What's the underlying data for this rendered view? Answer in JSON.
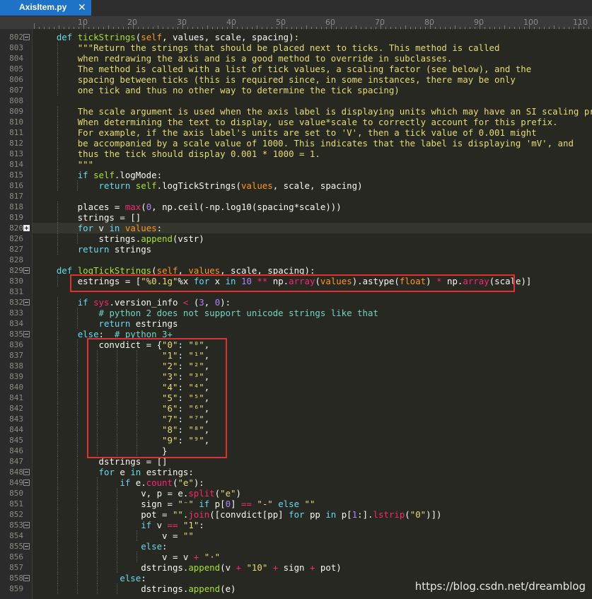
{
  "tab": {
    "title": "AxisItem.py",
    "close_glyph": "✕"
  },
  "ruler": {
    "labels": [
      "10",
      "20",
      "30",
      "40",
      "50",
      "60",
      "70",
      "80",
      "90",
      "100",
      "110"
    ]
  },
  "colors": {
    "keyword": "#66d9ef",
    "string": "#e6db74",
    "comment": "#75d3c3",
    "number": "#ae81ff",
    "builtin": "#a6e22e",
    "param": "#fd971f",
    "operator": "#f92672",
    "default": "#f8f8f2",
    "annotation_box": "#e03030"
  },
  "lines": [
    {
      "num": "802",
      "fold": "open",
      "tokens": [
        [
          "    "
        ],
        [
          "def",
          "kw"
        ],
        [
          " "
        ],
        [
          "tickStrings",
          "fn"
        ],
        [
          "("
        ],
        [
          "self",
          "par"
        ],
        [
          ", values, scale, spacing):"
        ]
      ]
    },
    {
      "num": "803",
      "tokens": [
        [
          "        "
        ],
        [
          "\"\"\"Return the strings that should be placed next to ticks. This method is called",
          "str"
        ]
      ]
    },
    {
      "num": "804",
      "tokens": [
        [
          "        "
        ],
        [
          "when redrawing the axis and is a good method to override in subclasses.",
          "str"
        ]
      ]
    },
    {
      "num": "805",
      "tokens": [
        [
          "        "
        ],
        [
          "The method is called with a list of tick values, a scaling factor (see below), and the",
          "str"
        ]
      ]
    },
    {
      "num": "806",
      "tokens": [
        [
          "        "
        ],
        [
          "spacing between ticks (this is required since, in some instances, there may be only",
          "str"
        ]
      ]
    },
    {
      "num": "807",
      "tokens": [
        [
          "        "
        ],
        [
          "one tick and thus no other way to determine the tick spacing)",
          "str"
        ]
      ]
    },
    {
      "num": "808",
      "tokens": [
        [
          ""
        ]
      ]
    },
    {
      "num": "809",
      "tokens": [
        [
          "        "
        ],
        [
          "The scale argument is used when the axis label is displaying units which may have an SI scaling prefix.",
          "str"
        ]
      ]
    },
    {
      "num": "810",
      "tokens": [
        [
          "        "
        ],
        [
          "When determining the text to display, use value*scale to correctly account for this prefix.",
          "str"
        ]
      ]
    },
    {
      "num": "811",
      "tokens": [
        [
          "        "
        ],
        [
          "For example, if the axis label's units are set to 'V', then a tick value of 0.001 might",
          "str"
        ]
      ]
    },
    {
      "num": "812",
      "tokens": [
        [
          "        "
        ],
        [
          "be accompanied by a scale value of 1000. This indicates that the label is displaying 'mV', and",
          "str"
        ]
      ]
    },
    {
      "num": "813",
      "tokens": [
        [
          "        "
        ],
        [
          "thus the tick should display 0.001 * 1000 = 1.",
          "str"
        ]
      ]
    },
    {
      "num": "814",
      "tokens": [
        [
          "        "
        ],
        [
          "\"\"\"",
          "str"
        ]
      ]
    },
    {
      "num": "815",
      "tokens": [
        [
          "        "
        ],
        [
          "if",
          "kw"
        ],
        [
          " "
        ],
        [
          "self",
          "bi"
        ],
        [
          ".logMode:"
        ]
      ]
    },
    {
      "num": "816",
      "tokens": [
        [
          "            "
        ],
        [
          "return",
          "kw"
        ],
        [
          " "
        ],
        [
          "self",
          "bi"
        ],
        [
          ".logTickStrings("
        ],
        [
          "values",
          "par"
        ],
        [
          ", scale, spacing)"
        ]
      ]
    },
    {
      "num": "817",
      "tokens": [
        [
          ""
        ]
      ]
    },
    {
      "num": "818",
      "tokens": [
        [
          "        places = "
        ],
        [
          "max",
          "op"
        ],
        [
          "("
        ],
        [
          "0",
          "num"
        ],
        [
          ", np.ceil(-np.log10(spacing*scale)))"
        ]
      ]
    },
    {
      "num": "819",
      "tokens": [
        [
          "        strings = []"
        ]
      ]
    },
    {
      "num": "820",
      "fold": "collapsed",
      "hl": true,
      "tokens": [
        [
          "        "
        ],
        [
          "for",
          "kw"
        ],
        [
          " v "
        ],
        [
          "in",
          "kw"
        ],
        [
          " "
        ],
        [
          "values",
          "par"
        ],
        [
          ":"
        ]
      ]
    },
    {
      "num": "826",
      "tokens": [
        [
          "            strings."
        ],
        [
          "append",
          "bi"
        ],
        [
          "(vstr)"
        ]
      ]
    },
    {
      "num": "827",
      "tokens": [
        [
          "        "
        ],
        [
          "return",
          "kw"
        ],
        [
          " strings"
        ]
      ]
    },
    {
      "num": "828",
      "tokens": [
        [
          ""
        ]
      ]
    },
    {
      "num": "829",
      "fold": "open",
      "tokens": [
        [
          "    "
        ],
        [
          "def",
          "kw"
        ],
        [
          " "
        ],
        [
          "logTickStrings",
          "fn"
        ],
        [
          "("
        ],
        [
          "self",
          "par"
        ],
        [
          ", "
        ],
        [
          "values",
          "par"
        ],
        [
          ", scale, spacing):"
        ]
      ]
    },
    {
      "num": "830",
      "tokens": [
        [
          "        estrings = ["
        ],
        [
          "\"%0.1g\"",
          "str"
        ],
        [
          "%x "
        ],
        [
          "for",
          "kw"
        ],
        [
          " x "
        ],
        [
          "in",
          "kw"
        ],
        [
          " "
        ],
        [
          "10",
          "num"
        ],
        [
          " "
        ],
        [
          "**",
          "op"
        ],
        [
          " np."
        ],
        [
          "array",
          "op"
        ],
        [
          "("
        ],
        [
          "values",
          "par"
        ],
        [
          ").astype("
        ],
        [
          "float",
          "par"
        ],
        [
          ") "
        ],
        [
          "*",
          "op"
        ],
        [
          " np."
        ],
        [
          "array",
          "op"
        ],
        [
          "(scale)]"
        ]
      ]
    },
    {
      "num": "831",
      "tokens": [
        [
          ""
        ]
      ]
    },
    {
      "num": "832",
      "fold": "open",
      "tokens": [
        [
          "        "
        ],
        [
          "if",
          "kw"
        ],
        [
          " "
        ],
        [
          "sys",
          "op"
        ],
        [
          ".version_info "
        ],
        [
          "<",
          "op"
        ],
        [
          " ("
        ],
        [
          "3",
          "num"
        ],
        [
          ", "
        ],
        [
          "0",
          "num"
        ],
        [
          "):"
        ]
      ]
    },
    {
      "num": "833",
      "tokens": [
        [
          "            "
        ],
        [
          "# python 2 does not support unicode strings like that",
          "cm"
        ]
      ]
    },
    {
      "num": "834",
      "tokens": [
        [
          "            "
        ],
        [
          "return",
          "kw"
        ],
        [
          " estrings"
        ]
      ]
    },
    {
      "num": "835",
      "fold": "open",
      "tokens": [
        [
          "        "
        ],
        [
          "else",
          "kw"
        ],
        [
          ":  "
        ],
        [
          "# python 3+",
          "cm"
        ]
      ]
    },
    {
      "num": "836",
      "tokens": [
        [
          "            convdict = {"
        ],
        [
          "\"0\"",
          "str"
        ],
        [
          ": "
        ],
        [
          "\"⁰\"",
          "str"
        ],
        [
          ","
        ]
      ]
    },
    {
      "num": "837",
      "tokens": [
        [
          "                        "
        ],
        [
          "\"1\"",
          "str"
        ],
        [
          ": "
        ],
        [
          "\"¹\"",
          "str"
        ],
        [
          ","
        ]
      ]
    },
    {
      "num": "838",
      "tokens": [
        [
          "                        "
        ],
        [
          "\"2\"",
          "str"
        ],
        [
          ": "
        ],
        [
          "\"²\"",
          "str"
        ],
        [
          ","
        ]
      ]
    },
    {
      "num": "839",
      "tokens": [
        [
          "                        "
        ],
        [
          "\"3\"",
          "str"
        ],
        [
          ": "
        ],
        [
          "\"³\"",
          "str"
        ],
        [
          ","
        ]
      ]
    },
    {
      "num": "840",
      "tokens": [
        [
          "                        "
        ],
        [
          "\"4\"",
          "str"
        ],
        [
          ": "
        ],
        [
          "\"⁴\"",
          "str"
        ],
        [
          ","
        ]
      ]
    },
    {
      "num": "841",
      "tokens": [
        [
          "                        "
        ],
        [
          "\"5\"",
          "str"
        ],
        [
          ": "
        ],
        [
          "\"⁵\"",
          "str"
        ],
        [
          ","
        ]
      ]
    },
    {
      "num": "842",
      "tokens": [
        [
          "                        "
        ],
        [
          "\"6\"",
          "str"
        ],
        [
          ": "
        ],
        [
          "\"⁶\"",
          "str"
        ],
        [
          ","
        ]
      ]
    },
    {
      "num": "843",
      "tokens": [
        [
          "                        "
        ],
        [
          "\"7\"",
          "str"
        ],
        [
          ": "
        ],
        [
          "\"⁷\"",
          "str"
        ],
        [
          ","
        ]
      ]
    },
    {
      "num": "844",
      "tokens": [
        [
          "                        "
        ],
        [
          "\"8\"",
          "str"
        ],
        [
          ": "
        ],
        [
          "\"⁸\"",
          "str"
        ],
        [
          ","
        ]
      ]
    },
    {
      "num": "845",
      "tokens": [
        [
          "                        "
        ],
        [
          "\"9\"",
          "str"
        ],
        [
          ": "
        ],
        [
          "\"⁹\"",
          "str"
        ],
        [
          ","
        ]
      ]
    },
    {
      "num": "846",
      "tokens": [
        [
          "                        }"
        ]
      ]
    },
    {
      "num": "847",
      "tokens": [
        [
          "            dstrings = []"
        ]
      ]
    },
    {
      "num": "848",
      "fold": "open",
      "tokens": [
        [
          "            "
        ],
        [
          "for",
          "kw"
        ],
        [
          " e "
        ],
        [
          "in",
          "kw"
        ],
        [
          " estrings:"
        ]
      ]
    },
    {
      "num": "849",
      "fold": "open",
      "tokens": [
        [
          "                "
        ],
        [
          "if",
          "kw"
        ],
        [
          " e."
        ],
        [
          "count",
          "op"
        ],
        [
          "("
        ],
        [
          "\"e\"",
          "str"
        ],
        [
          "):"
        ]
      ]
    },
    {
      "num": "850",
      "tokens": [
        [
          "                    v, p = e."
        ],
        [
          "split",
          "op"
        ],
        [
          "("
        ],
        [
          "\"e\"",
          "str"
        ],
        [
          ")"
        ]
      ]
    },
    {
      "num": "851",
      "tokens": [
        [
          "                    sign = "
        ],
        [
          "\"⁻\"",
          "str"
        ],
        [
          " "
        ],
        [
          "if",
          "kw"
        ],
        [
          " p["
        ],
        [
          "0",
          "num"
        ],
        [
          "] "
        ],
        [
          "==",
          "op"
        ],
        [
          " "
        ],
        [
          "\"-\"",
          "str"
        ],
        [
          " "
        ],
        [
          "else",
          "kw"
        ],
        [
          " "
        ],
        [
          "\"\"",
          "str"
        ]
      ]
    },
    {
      "num": "852",
      "tokens": [
        [
          "                    pot = "
        ],
        [
          "\"\"",
          "str"
        ],
        [
          "."
        ],
        [
          "join",
          "op"
        ],
        [
          "([convdict[pp] "
        ],
        [
          "for",
          "kw"
        ],
        [
          " pp "
        ],
        [
          "in",
          "kw"
        ],
        [
          " p["
        ],
        [
          "1",
          "num"
        ],
        [
          ":]."
        ],
        [
          "lstrip",
          "op"
        ],
        [
          "("
        ],
        [
          "\"0\"",
          "str"
        ],
        [
          ")])"
        ]
      ]
    },
    {
      "num": "853",
      "fold": "open",
      "tokens": [
        [
          "                    "
        ],
        [
          "if",
          "kw"
        ],
        [
          " v "
        ],
        [
          "==",
          "op"
        ],
        [
          " "
        ],
        [
          "\"1\"",
          "str"
        ],
        [
          ":"
        ]
      ]
    },
    {
      "num": "854",
      "tokens": [
        [
          "                        v = "
        ],
        [
          "\"\"",
          "str"
        ]
      ]
    },
    {
      "num": "855",
      "fold": "open",
      "tokens": [
        [
          "                    "
        ],
        [
          "else",
          "kw"
        ],
        [
          ":"
        ]
      ]
    },
    {
      "num": "856",
      "tokens": [
        [
          "                        v = v "
        ],
        [
          "+",
          "op"
        ],
        [
          " "
        ],
        [
          "\"·\"",
          "str"
        ]
      ]
    },
    {
      "num": "857",
      "tokens": [
        [
          "                    dstrings."
        ],
        [
          "append",
          "bi"
        ],
        [
          "(v "
        ],
        [
          "+",
          "op"
        ],
        [
          " "
        ],
        [
          "\"10\"",
          "str"
        ],
        [
          " "
        ],
        [
          "+",
          "op"
        ],
        [
          " sign "
        ],
        [
          "+",
          "op"
        ],
        [
          " pot)"
        ]
      ]
    },
    {
      "num": "858",
      "fold": "open",
      "tokens": [
        [
          "                "
        ],
        [
          "else",
          "kw"
        ],
        [
          ":"
        ]
      ]
    },
    {
      "num": "859",
      "tokens": [
        [
          "                    dstrings."
        ],
        [
          "append",
          "bi"
        ],
        [
          "(e)"
        ]
      ]
    }
  ],
  "watermark": "https://blog.csdn.net/dreamblog"
}
